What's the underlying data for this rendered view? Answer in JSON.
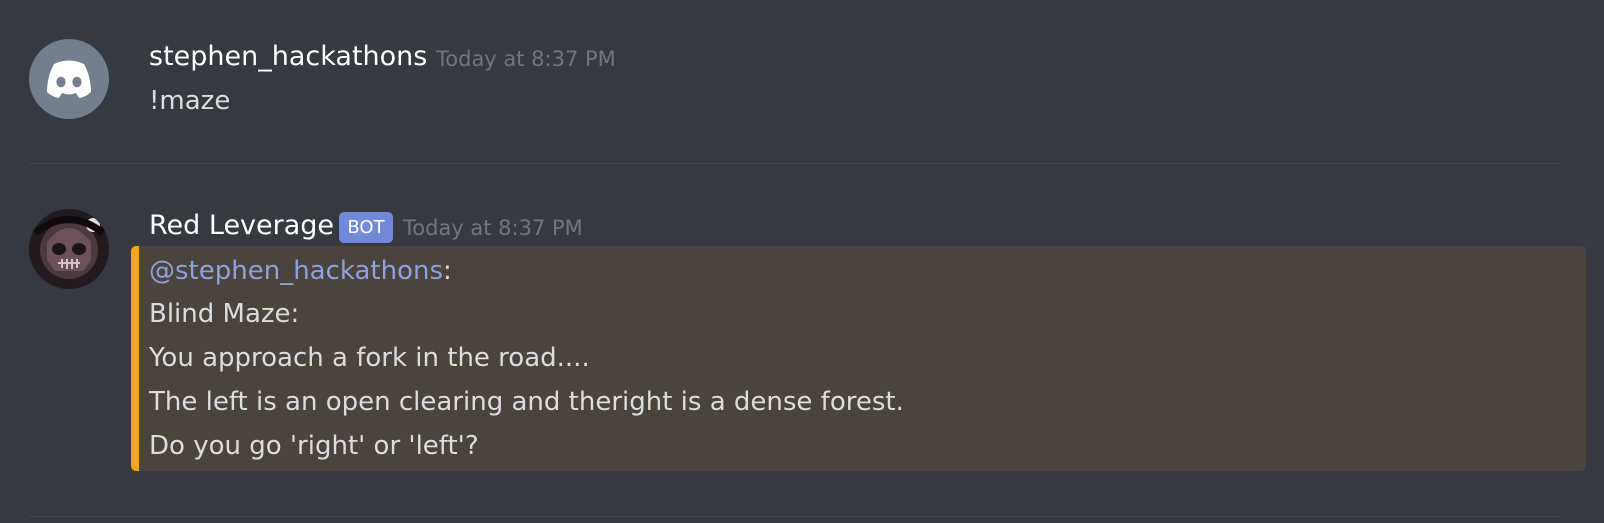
{
  "messages": [
    {
      "username": "stephen_hackathons",
      "timestamp": "Today at 8:37 PM",
      "text": "!maze",
      "avatar_icon": "discord-logo-icon"
    },
    {
      "username": "Red Leverage",
      "tag": "BOT",
      "timestamp": "Today at 8:37 PM",
      "avatar_icon": "skull-avatar-icon",
      "embed": {
        "accent_color": "#faa61a",
        "mention": "@stephen_hackathons",
        "mention_suffix": ":",
        "title": "Blind Maze:",
        "lines": [
          "You approach a fork in the road....",
          "The left is an open clearing and theright is a dense forest.",
          "Do you go 'right' or 'left'?"
        ]
      }
    }
  ],
  "colors": {
    "background": "#36393f",
    "mention": "#8ea1e1",
    "bot_tag": "#7289da",
    "embed_background": "#4a443c",
    "embed_accent": "#faa61a"
  }
}
